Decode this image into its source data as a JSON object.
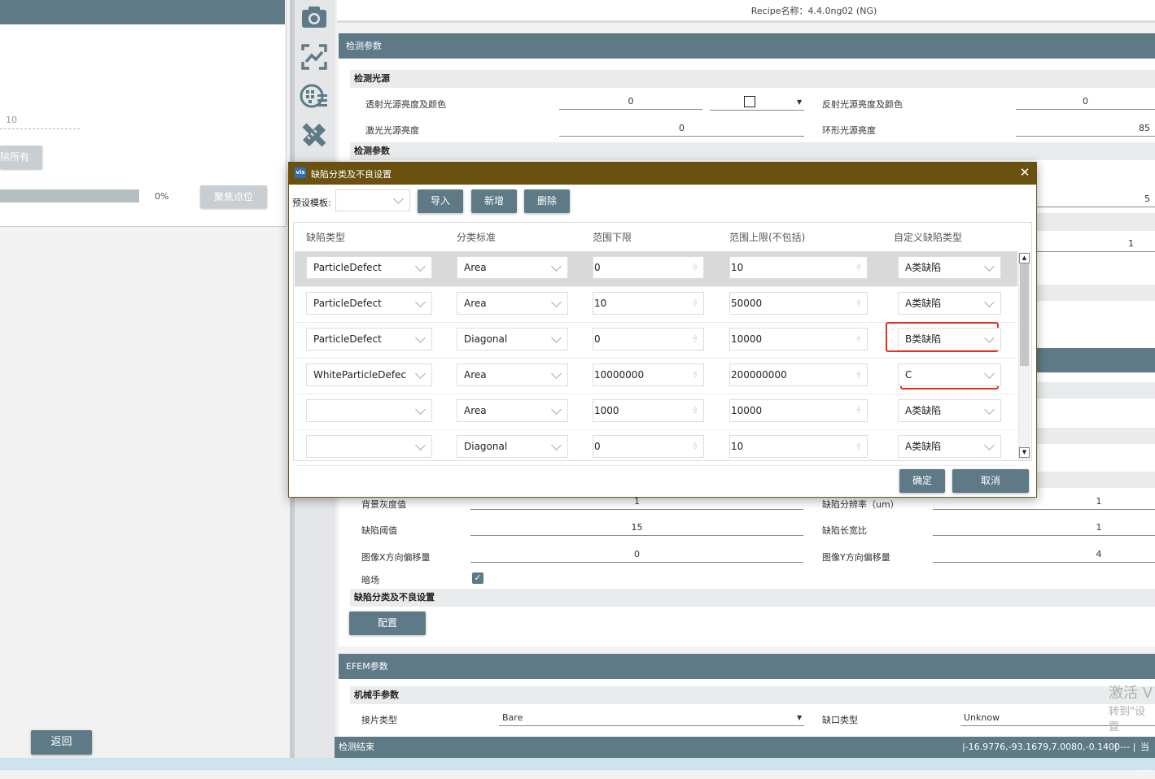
{
  "left": {
    "value": "10",
    "clear_label": "除所有",
    "progress_text": "0%",
    "progress_fraction": 0.0,
    "focus_label": "聚焦点位",
    "back_label": "返回"
  },
  "toolbar": {
    "icons": [
      "camera-icon",
      "image-adjust-icon",
      "wafer-map-icon",
      "ruler-pencil-icon"
    ]
  },
  "recipe": {
    "title": "Recipe名称：4.4.0ng02 (NG)"
  },
  "detect": {
    "section_title": "检测参数",
    "light_source_title": "检测光源",
    "transmit_label": "透射光源亮度及颜色",
    "transmit_value": "0",
    "reflect_label": "反射光源亮度及颜色",
    "reflect_value": "0",
    "laser_label": "激光光源亮度",
    "laser_value": "0",
    "ring_label": "环形光源亮度",
    "ring_value": "85",
    "params_title": "检测参数",
    "partial_value_1": "5",
    "partial_value_2": "1",
    "bg_gray_label": "背景灰度值",
    "bg_gray_value": "1",
    "defect_res_label": "缺陷分辨率（um）",
    "defect_res_value": "1",
    "defect_thresh_label": "缺陷阈值",
    "defect_thresh_value": "15",
    "aspect_label": "缺陷长宽比",
    "aspect_value": "1",
    "offset_x_label": "图像X方向偏移量",
    "offset_x_value": "0",
    "offset_y_label": "图像Y方向偏移量",
    "offset_y_value": "4",
    "darkfield_label": "暗场",
    "darkfield_checked": true,
    "classify_title": "缺陷分类及不良设置",
    "config_label": "配置"
  },
  "efem": {
    "section_title": "EFEM参数",
    "robot_title": "机械手参数",
    "wafer_type_label": "接片类型",
    "wafer_type_value": "Bare",
    "notch_label": "缺口类型",
    "notch_value": "Unknow"
  },
  "watermark": {
    "line1": "激活 V",
    "line2": "转到\"设置"
  },
  "status": {
    "left_text": "检测结束",
    "coords": "|-16.9776,-93.1679,7.0080,-0.1400",
    "sep": "| --- |",
    "right_text": "当前"
  },
  "dialog": {
    "icon_text": "vis",
    "title": "缺陷分类及不良设置",
    "preset_label": "预设模板:",
    "preset_value": "",
    "import_label": "导入",
    "add_label": "新增",
    "delete_label": "删除",
    "columns": [
      "缺陷类型",
      "分类标准",
      "范围下限",
      "范围上限(不包括)",
      "自定义缺陷类型"
    ],
    "rows": [
      {
        "type": "ParticleDefect",
        "criterion": "Area",
        "lower": "0",
        "upper": "10",
        "custom": "A类缺陷"
      },
      {
        "type": "ParticleDefect",
        "criterion": "Area",
        "lower": "10",
        "upper": "50000",
        "custom": "A类缺陷"
      },
      {
        "type": "ParticleDefect",
        "criterion": "Diagonal",
        "lower": "0",
        "upper": "10000",
        "custom": "B类缺陷"
      },
      {
        "type": "WhiteParticleDefec",
        "criterion": "Area",
        "lower": "10000000",
        "upper": "200000000",
        "custom": "C"
      },
      {
        "type": "",
        "criterion": "Area",
        "lower": "1000",
        "upper": "10000",
        "custom": "A类缺陷"
      },
      {
        "type": "",
        "criterion": "Diagonal",
        "lower": "0",
        "upper": "10",
        "custom": "A类缺陷"
      }
    ],
    "ok_label": "确定",
    "cancel_label": "取消"
  },
  "colors": {
    "header": "#5e7a86",
    "dialog_title": "#6b5110",
    "highlight": "#e0321e"
  }
}
